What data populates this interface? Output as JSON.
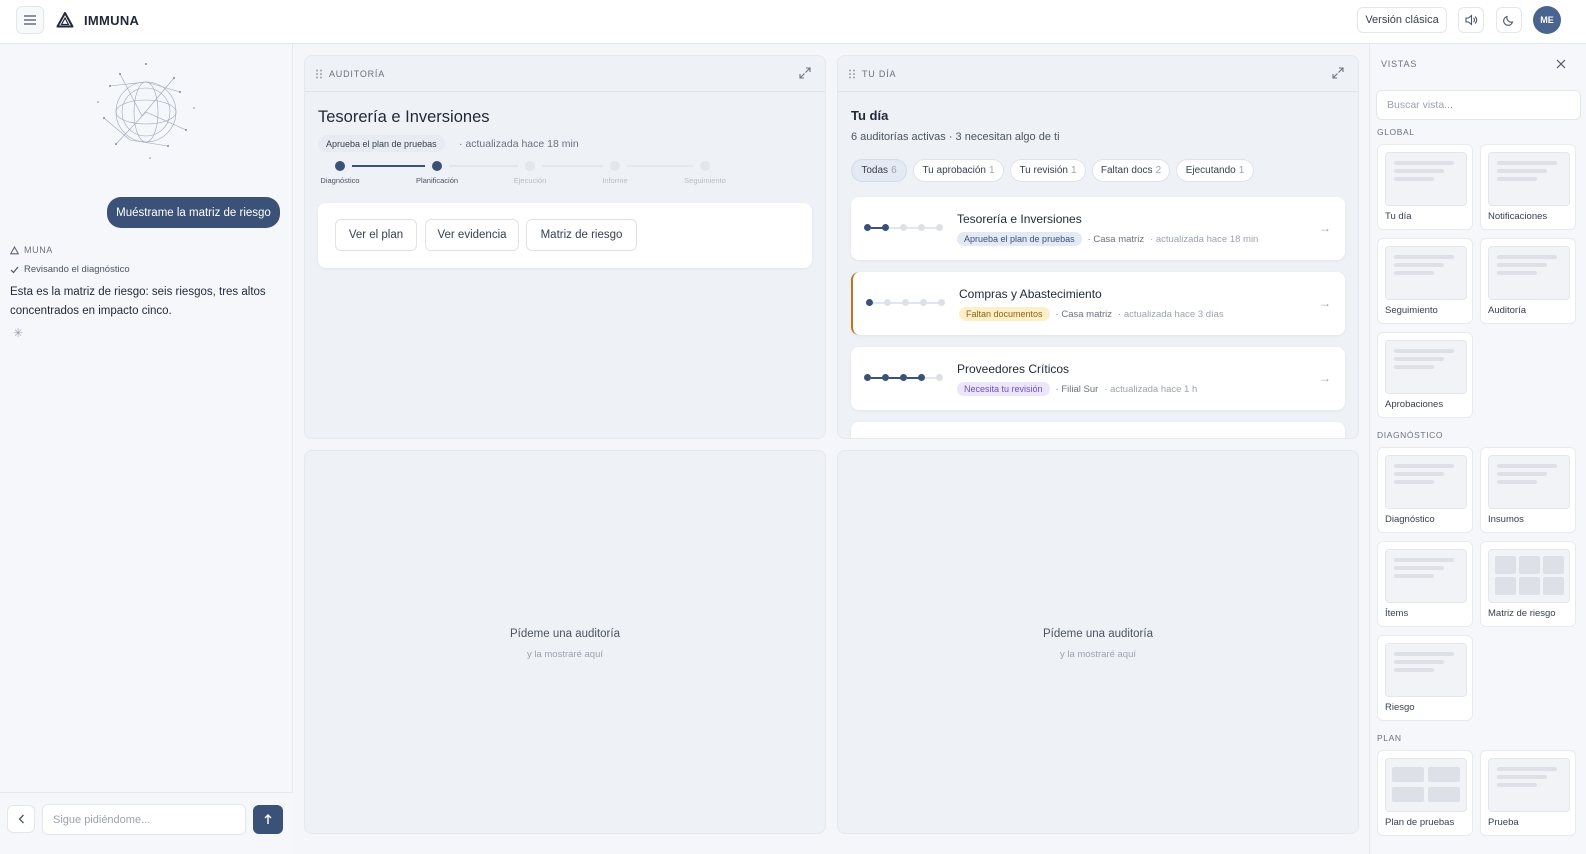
{
  "app": {
    "brand": "IMMUNA"
  },
  "topbar": {
    "classic_label": "Versión clásica",
    "avatar_initials": "ME"
  },
  "chat": {
    "user_message": "Muéstrame la matriz de riesgo",
    "agent_name": "MUNA",
    "agent_status": "Revisando el diagnóstico",
    "agent_message": "Esta es la matriz de riesgo: seis riesgos, tres altos concentrados en impacto cinco.",
    "input_placeholder": "Sigue pidiéndome..."
  },
  "audit_panel": {
    "title": "AUDITORÍA",
    "audit_name": "Tesorería e Inversiones",
    "status_pill": "Aprueba el plan de pruebas",
    "updated": "· actualizada hace 18 min",
    "steps": [
      "Diagnóstico",
      "Planificación",
      "Ejecución",
      "Informe",
      "Seguimiento"
    ],
    "current_step": 2,
    "actions": [
      "Ver el plan",
      "Ver evidencia",
      "Matriz de riesgo"
    ]
  },
  "day_panel": {
    "title": "TU DÍA",
    "heading": "Tu día",
    "subtitle": "6 auditorías activas · 3 necesitan algo de ti",
    "filters": [
      {
        "label": "Todas",
        "count": "6"
      },
      {
        "label": "Tu aprobación",
        "count": "1"
      },
      {
        "label": "Tu revisión",
        "count": "1"
      },
      {
        "label": "Faltan docs",
        "count": "2"
      },
      {
        "label": "Ejecutando",
        "count": "1"
      }
    ],
    "audits": [
      {
        "name": "Tesorería e Inversiones",
        "tag": "Aprueba el plan de pruebas",
        "entity": "· Casa matriz",
        "updated": "· actualizada hace 18 min",
        "step": 2,
        "tag_color": "#e3eaf6",
        "tag_text_color": "#3b5177"
      },
      {
        "name": "Compras y Abastecimiento",
        "tag": "Faltan documentos",
        "entity": "· Casa matriz",
        "updated": "· actualizada hace 3 días",
        "step": 1,
        "tag_color": "#fdf0c8",
        "tag_text_color": "#92610e"
      },
      {
        "name": "Proveedores Críticos",
        "tag": "Necesita tu revisión",
        "entity": "· Filial Sur",
        "updated": "· actualizada hace 1 h",
        "step": 4,
        "tag_color": "#ece6fa",
        "tag_text_color": "#6d4fc4"
      }
    ]
  },
  "empty_panels": [
    {
      "title": "Pídeme una auditoría",
      "sub": "y la mostraré aquí"
    },
    {
      "title": "Pídeme una auditoría",
      "sub": "y la mostraré aquí"
    }
  ],
  "views": {
    "title": "VISTAS",
    "search_placeholder": "Buscar vista...",
    "sections": [
      {
        "label": "GLOBAL",
        "items": [
          "Tu día",
          "Notificaciones",
          "Seguimiento",
          "Auditoría",
          "Aprobaciones"
        ]
      },
      {
        "label": "DIAGNÓSTICO",
        "items": [
          "Diagnóstico",
          "Insumos",
          "Ítems",
          "Matriz de riesgo",
          "Riesgo"
        ]
      },
      {
        "label": "PLAN",
        "items": [
          "Plan de pruebas",
          "Prueba"
        ]
      }
    ]
  },
  "colors": {
    "accent": "#3b5177",
    "warning": "#b7791f"
  }
}
